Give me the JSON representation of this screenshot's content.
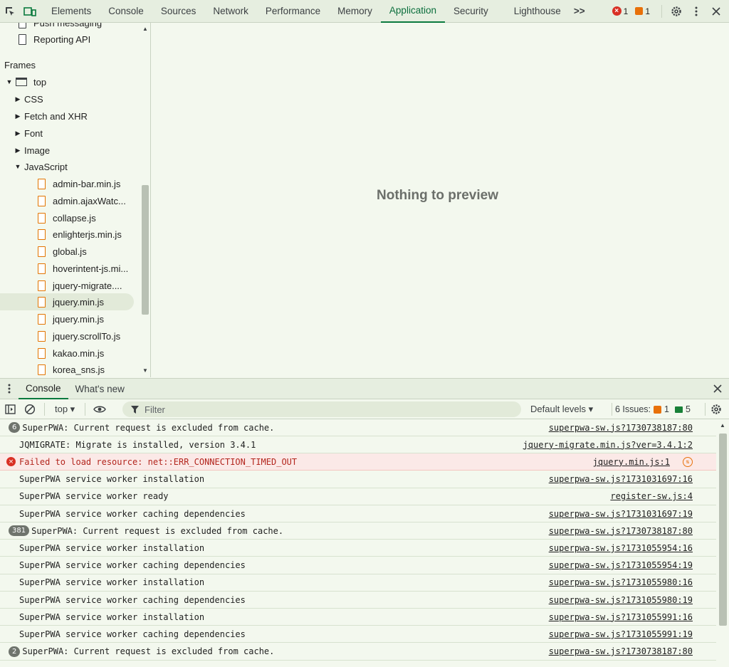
{
  "topbar": {
    "tabs": [
      "Elements",
      "Console",
      "Sources",
      "Network",
      "Performance",
      "Memory",
      "Application",
      "Security",
      "Lighthouse"
    ],
    "active_tab": "Application",
    "more_label": ">>",
    "error_count": "1",
    "warning_count": "1"
  },
  "sidebar": {
    "items": [
      {
        "label": "Push messaging",
        "kind": "file-gray"
      },
      {
        "label": "Reporting API",
        "kind": "file-gray"
      },
      {
        "label": "Frames",
        "kind": "section"
      },
      {
        "label": "top",
        "kind": "frame"
      },
      {
        "label": "CSS",
        "kind": "folder"
      },
      {
        "label": "Fetch and XHR",
        "kind": "folder"
      },
      {
        "label": "Font",
        "kind": "folder"
      },
      {
        "label": "Image",
        "kind": "folder"
      },
      {
        "label": "JavaScript",
        "kind": "folder-open"
      },
      {
        "label": "admin-bar.min.js",
        "kind": "file"
      },
      {
        "label": "admin.ajaxWatc...",
        "kind": "file"
      },
      {
        "label": "collapse.js",
        "kind": "file"
      },
      {
        "label": "enlighterjs.min.js",
        "kind": "file"
      },
      {
        "label": "global.js",
        "kind": "file"
      },
      {
        "label": "hoverintent-js.mi...",
        "kind": "file"
      },
      {
        "label": "jquery-migrate....",
        "kind": "file"
      },
      {
        "label": "jquery.min.js",
        "kind": "file"
      },
      {
        "label": "jquery.min.js",
        "kind": "file"
      },
      {
        "label": "jquery.scrollTo.js",
        "kind": "file"
      },
      {
        "label": "kakao.min.js",
        "kind": "file"
      },
      {
        "label": "korea_sns.js",
        "kind": "file"
      }
    ]
  },
  "preview": {
    "empty_text": "Nothing to preview"
  },
  "drawer": {
    "tabs": [
      "Console",
      "What's new"
    ],
    "active_tab": "Console"
  },
  "console_toolbar": {
    "context": "top ▾",
    "filter_placeholder": "Filter",
    "levels": "Default levels ▾",
    "issues_label": "6 Issues:",
    "issues_warn": "1",
    "issues_info": "5"
  },
  "console_log": [
    {
      "count": "6",
      "text": "SuperPWA: Current request is excluded from cache.",
      "source": "superpwa-sw.js?1730738187:80",
      "type": "log"
    },
    {
      "count": "",
      "text": "JQMIGRATE: Migrate is installed, version 3.4.1",
      "source": "jquery-migrate.min.js?ver=3.4.1:2",
      "type": "log"
    },
    {
      "count": "",
      "text": "Failed to load resource: net::ERR_CONNECTION_TIMED_OUT",
      "source": "jquery.min.js:1",
      "type": "error"
    },
    {
      "count": "",
      "text": "SuperPWA service worker installation",
      "source": "superpwa-sw.js?1731031697:16",
      "type": "log"
    },
    {
      "count": "",
      "text": "SuperPWA service worker ready",
      "source": "register-sw.js:4",
      "type": "log"
    },
    {
      "count": "",
      "text": "SuperPWA service worker caching dependencies",
      "source": "superpwa-sw.js?1731031697:19",
      "type": "log"
    },
    {
      "count": "381",
      "text": "SuperPWA: Current request is excluded from cache.",
      "source": "superpwa-sw.js?1730738187:80",
      "type": "log"
    },
    {
      "count": "",
      "text": "SuperPWA service worker installation",
      "source": "superpwa-sw.js?1731055954:16",
      "type": "log"
    },
    {
      "count": "",
      "text": "SuperPWA service worker caching dependencies",
      "source": "superpwa-sw.js?1731055954:19",
      "type": "log"
    },
    {
      "count": "",
      "text": "SuperPWA service worker installation",
      "source": "superpwa-sw.js?1731055980:16",
      "type": "log"
    },
    {
      "count": "",
      "text": "SuperPWA service worker caching dependencies",
      "source": "superpwa-sw.js?1731055980:19",
      "type": "log"
    },
    {
      "count": "",
      "text": "SuperPWA service worker installation",
      "source": "superpwa-sw.js?1731055991:16",
      "type": "log"
    },
    {
      "count": "",
      "text": "SuperPWA service worker caching dependencies",
      "source": "superpwa-sw.js?1731055991:19",
      "type": "log"
    },
    {
      "count": "2",
      "text": "SuperPWA: Current request is excluded from cache.",
      "source": "superpwa-sw.js?1730738187:80",
      "type": "log"
    }
  ],
  "colors": {
    "accent": "#0b7a3e",
    "background": "#f3f8ee",
    "error_bg": "#fbe9e7",
    "error_text": "#b3261e"
  }
}
